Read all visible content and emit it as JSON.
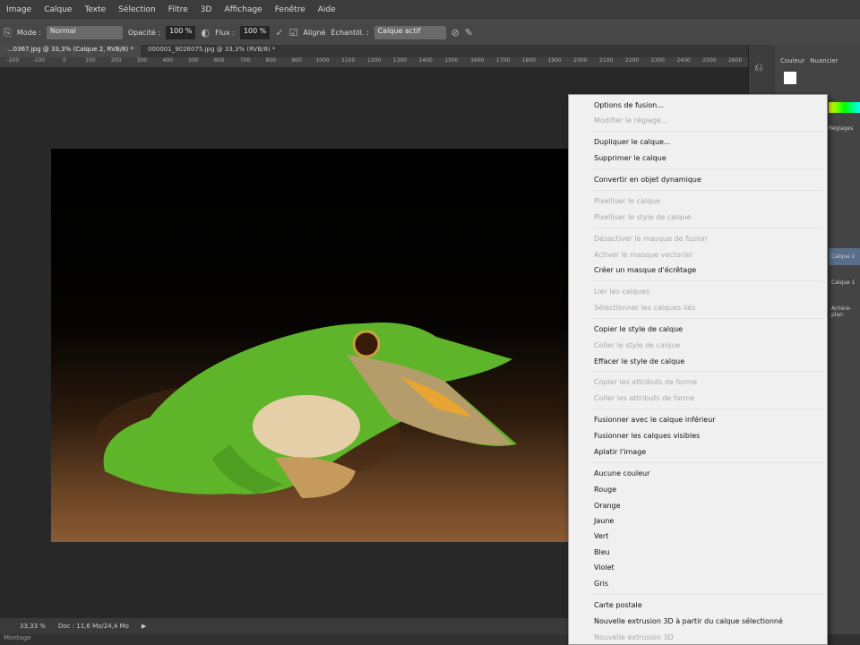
{
  "menubar": [
    "Image",
    "Calque",
    "Texte",
    "Sélection",
    "Filtre",
    "3D",
    "Affichage",
    "Fenêtre",
    "Aide"
  ],
  "options": {
    "mode_label": "Mode :",
    "mode_value": "Normal",
    "opacity_label": "Opacité :",
    "opacity_value": "100 %",
    "flow_label": "Flux :",
    "flow_value": "100 %",
    "aligned_label": "Aligné",
    "sample_label": "Échantill. :",
    "sample_value": "Calque actif"
  },
  "tabs": [
    "...0367.jpg @ 33,3% (Calque 2, RVB/8) *",
    "000001_9026075.jpg @ 33,3% (RVB/8) *"
  ],
  "ruler": [
    "-200",
    "-100",
    "0",
    "100",
    "200",
    "300",
    "400",
    "500",
    "600",
    "700",
    "800",
    "900",
    "1000",
    "1100",
    "1200",
    "1300",
    "1400",
    "1500",
    "1600",
    "1700",
    "1800",
    "1900",
    "2000",
    "2100",
    "2200",
    "2300",
    "2400",
    "2500",
    "2600"
  ],
  "status": {
    "zoom": "33,33 %",
    "doc": "Doc : 11,6 Mo/24,4 Mo"
  },
  "bottom": "Montage",
  "panels": {
    "color_tab": "Couleur",
    "swatches_tab": "Nuancier",
    "adjust": "Réglages",
    "layer1": "Calque 2",
    "layer2": "Calque 1",
    "layer3": "Arrière-plan"
  },
  "context_menu": [
    {
      "label": "Options de fusion...",
      "enabled": true
    },
    {
      "label": "Modifier le réglage...",
      "enabled": false
    },
    {
      "label": "Dupliquer le calque...",
      "enabled": true
    },
    {
      "label": "Supprimer le calque",
      "enabled": true
    },
    {
      "label": "Convertir en objet dynamique",
      "enabled": true
    },
    {
      "label": "Pixelliser le calque",
      "enabled": false
    },
    {
      "label": "Pixelliser le style de calque",
      "enabled": false
    },
    {
      "label": "Désactiver le masque de fusion",
      "enabled": false
    },
    {
      "label": "Activer le masque vectoriel",
      "enabled": false
    },
    {
      "label": "Créer un masque d'écrêtage",
      "enabled": true
    },
    {
      "label": "Lier les calques",
      "enabled": false
    },
    {
      "label": "Sélectionner les calques liés",
      "enabled": false
    },
    {
      "label": "Copier le style de calque",
      "enabled": true
    },
    {
      "label": "Coller le style de calque",
      "enabled": false
    },
    {
      "label": "Effacer le style de calque",
      "enabled": true
    },
    {
      "label": "Copier les attributs de forme",
      "enabled": false
    },
    {
      "label": "Coller les attributs de forme",
      "enabled": false
    },
    {
      "label": "Fusionner avec le calque inférieur",
      "enabled": true
    },
    {
      "label": "Fusionner les calques visibles",
      "enabled": true
    },
    {
      "label": "Aplatir l'image",
      "enabled": true
    },
    {
      "label": "Aucune couleur",
      "enabled": true
    },
    {
      "label": "Rouge",
      "enabled": true
    },
    {
      "label": "Orange",
      "enabled": true
    },
    {
      "label": "Jaune",
      "enabled": true
    },
    {
      "label": "Vert",
      "enabled": true
    },
    {
      "label": "Bleu",
      "enabled": true
    },
    {
      "label": "Violet",
      "enabled": true
    },
    {
      "label": "Gris",
      "enabled": true
    },
    {
      "label": "Carte postale",
      "enabled": true
    },
    {
      "label": "Nouvelle extrusion 3D à partir du calque sélectionné",
      "enabled": true
    },
    {
      "label": "Nouvelle extrusion 3D",
      "enabled": false
    }
  ]
}
